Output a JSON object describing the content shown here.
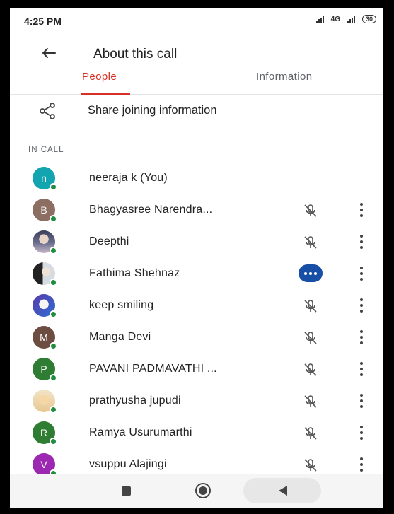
{
  "status_bar": {
    "time": "4:25 PM",
    "network": "4G",
    "battery": "30"
  },
  "app_bar": {
    "title": "About this call"
  },
  "tabs": [
    {
      "label": "People",
      "active": true
    },
    {
      "label": "Information",
      "active": false
    }
  ],
  "share": {
    "label": "Share joining information"
  },
  "section_label": "IN CALL",
  "participants": [
    {
      "name": "neeraja k (You)",
      "initial": "n",
      "avatar_color": "#12a4af",
      "status": "none"
    },
    {
      "name": "Bhagyasree Narendra...",
      "initial": "B",
      "avatar_color": "#8d6e63",
      "status": "muted"
    },
    {
      "name": "Deepthi",
      "initial": "",
      "avatar_color": "#3a3f58",
      "status": "muted"
    },
    {
      "name": "Fathima Shehnaz",
      "initial": "",
      "avatar_color": "#222222",
      "status": "speaking"
    },
    {
      "name": "keep smiling",
      "initial": "",
      "avatar_color": "#5a3aa8",
      "status": "muted"
    },
    {
      "name": "Manga Devi",
      "initial": "M",
      "avatar_color": "#6d4c41",
      "status": "muted"
    },
    {
      "name": "PAVANI PADMAVATHI ...",
      "initial": "P",
      "avatar_color": "#2e7d32",
      "status": "muted"
    },
    {
      "name": "prathyusha jupudi",
      "initial": "",
      "avatar_color": "#e8c791",
      "status": "muted"
    },
    {
      "name": "Ramya Usurumarthi",
      "initial": "R",
      "avatar_color": "#2e7d32",
      "status": "muted"
    },
    {
      "name": "vsuppu Alajingi",
      "initial": "V",
      "avatar_color": "#9c27b0",
      "status": "muted"
    }
  ],
  "colors": {
    "accent": "#d93025",
    "online": "#1e8e3e",
    "speaking": "#174ea6"
  },
  "icons": {
    "back": "arrow-left-icon",
    "share": "share-icon",
    "mic": "mic-off-icon",
    "more": "more-vert-icon"
  }
}
